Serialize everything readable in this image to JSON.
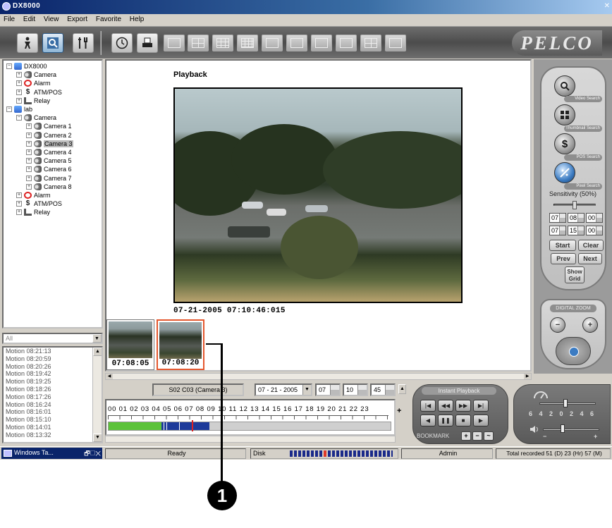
{
  "window": {
    "title": "DX8000"
  },
  "menu": [
    "File",
    "Edit",
    "View",
    "Export",
    "Favorite",
    "Help"
  ],
  "toolbar": {
    "tools": [
      "live-view-icon",
      "search-icon",
      "setup-icon",
      "clock-icon",
      "print-icon"
    ],
    "layouts": [
      "layout-1x1",
      "layout-2x2",
      "layout-3x3",
      "layout-4x4",
      "layout-1plus5",
      "layout-1plus7",
      "layout-1plus12",
      "layout-2plus8",
      "layout-1plus3",
      "layout-full"
    ],
    "logo": "PELCO"
  },
  "tree": {
    "items": [
      {
        "label": "DX8000",
        "icon": "server-icon",
        "level": 0
      },
      {
        "label": "Camera",
        "icon": "camera-icon",
        "level": 1
      },
      {
        "label": "Alarm",
        "icon": "alarm-icon",
        "level": 1
      },
      {
        "label": "ATM/POS",
        "icon": "atm-icon",
        "level": 1
      },
      {
        "label": "Relay",
        "icon": "relay-icon",
        "level": 1
      },
      {
        "label": "lab",
        "icon": "server-icon",
        "level": 0
      },
      {
        "label": "Camera",
        "icon": "camera-icon",
        "level": 1
      },
      {
        "label": "Camera 1",
        "icon": "camera-icon",
        "level": 2
      },
      {
        "label": "Camera 2",
        "icon": "camera-icon",
        "level": 2
      },
      {
        "label": "Camera 3",
        "icon": "camera-icon",
        "level": 2,
        "selected": true
      },
      {
        "label": "Camera 4",
        "icon": "camera-icon",
        "level": 2
      },
      {
        "label": "Camera 5",
        "icon": "camera-icon",
        "level": 2
      },
      {
        "label": "Camera 6",
        "icon": "camera-icon",
        "level": 2
      },
      {
        "label": "Camera 7",
        "icon": "camera-icon",
        "level": 2
      },
      {
        "label": "Camera 8",
        "icon": "camera-icon",
        "level": 2
      },
      {
        "label": "Alarm",
        "icon": "alarm-icon",
        "level": 1
      },
      {
        "label": "ATM/POS",
        "icon": "atm-icon",
        "level": 1
      },
      {
        "label": "Relay",
        "icon": "relay-icon",
        "level": 1
      }
    ]
  },
  "event_filter": {
    "value": "All"
  },
  "events": [
    "Motion 08:21:13",
    "Motion 08:20:59",
    "Motion 08:20:26",
    "Motion 08:19:42",
    "Motion 08:19:25",
    "Motion 08:18:26",
    "Motion 08:17:26",
    "Motion 08:16:24",
    "Motion 08:16:01",
    "Motion 08:15:10",
    "Motion 08:14:01",
    "Motion 08:13:32"
  ],
  "main": {
    "title": "Playback",
    "timestamp": "07-21-2005 07:10:46:015",
    "thumbnails": [
      {
        "time": "07:08:05",
        "selected": false
      },
      {
        "time": "07:08:20",
        "selected": true
      }
    ]
  },
  "search_panel": {
    "buttons": [
      {
        "icon": "video-search-icon",
        "label": "Video Search"
      },
      {
        "icon": "thumbnail-search-icon",
        "label": "Thumbnail Search"
      },
      {
        "icon": "pos-search-icon",
        "label": "POS Search"
      },
      {
        "icon": "pixel-search-icon",
        "label": "Pixel Search"
      }
    ],
    "sensitivity": "Sensitivity (50%)",
    "sensitivity_value": 0.5,
    "time_from": [
      "07",
      "08",
      "00"
    ],
    "time_to": [
      "07",
      "15",
      "00"
    ],
    "start": "Start",
    "clear": "Clear",
    "prev": "Prev",
    "next": "Next",
    "show_grid": "Show Grid"
  },
  "zoom": {
    "label": "DIGITAL ZOOM",
    "zoom_out": "−",
    "zoom_in": "+"
  },
  "playback_controls": {
    "camera": "S02 C03 (Camera 3)",
    "date": "07 - 21 - 2005",
    "hour": "07",
    "minute": "10",
    "second": "45",
    "hours_axis": "00  01  02  03  04  05  06  07  08  09  10  11  12  13  14  15  16  17  18  19  20  21  22  23",
    "instant_playback": "Instant Playback",
    "bookmark": "BOOKMARK",
    "speed_scale": "6 4 2 0 2 4 6"
  },
  "status": {
    "taskbar": "Windows Ta...",
    "state": "Ready",
    "disk": "Disk",
    "user": "Admin",
    "total_recorded": "Total recorded 51 (D) 23 (Hr) 57 (M)"
  },
  "callout": {
    "number": "1"
  },
  "colors": {
    "accent_blue": "#0a246a",
    "timeline_green": "#5cc23a",
    "timeline_blue": "#1d3a9a",
    "selection_orange": "#e4572e"
  }
}
